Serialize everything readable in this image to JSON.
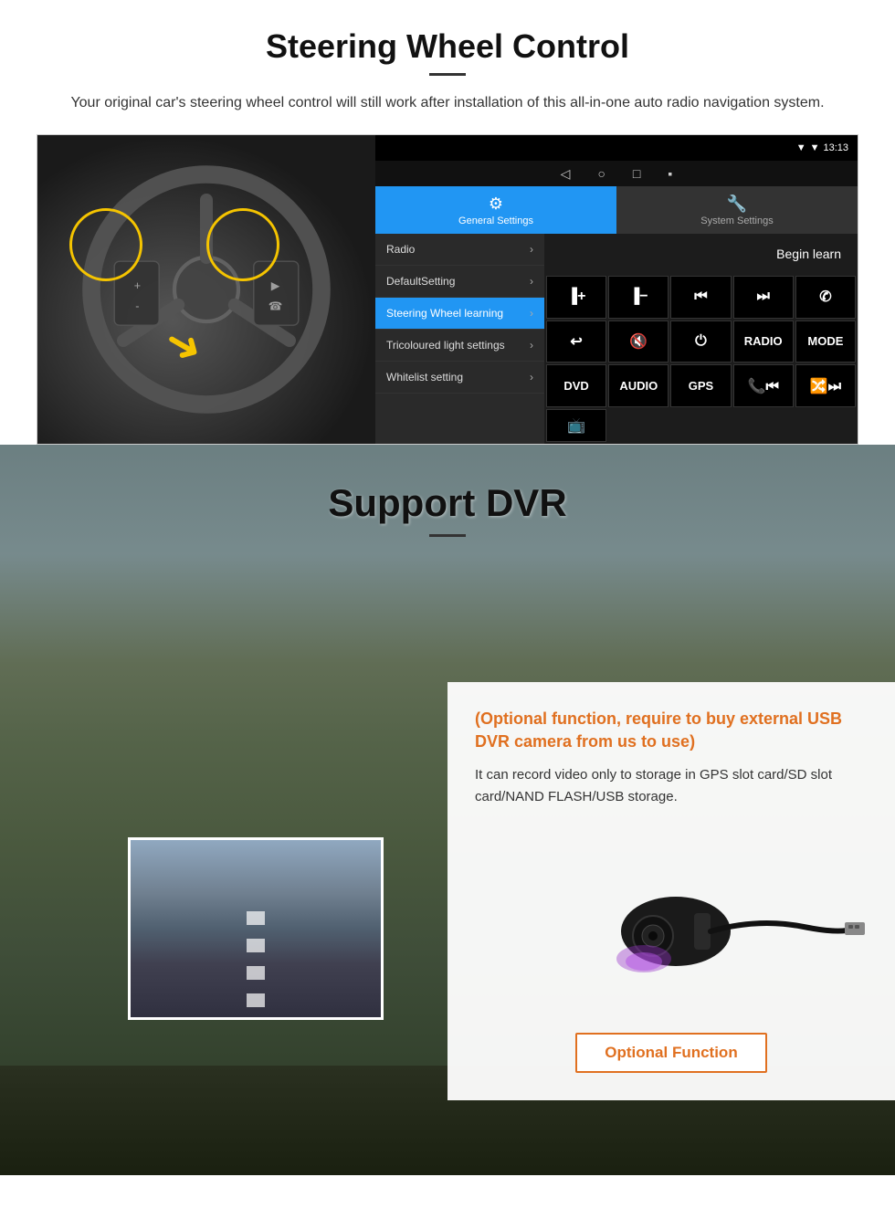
{
  "steering": {
    "title": "Steering Wheel Control",
    "subtitle": "Your original car's steering wheel control will still work after installation of this all-in-one auto radio navigation system.",
    "statusbar": {
      "time": "13:13",
      "icons": "▼ ▼"
    },
    "nav_icons": [
      "◁",
      "○",
      "□",
      "▪"
    ],
    "tabs": [
      {
        "label": "General Settings",
        "active": true,
        "icon": "⚙"
      },
      {
        "label": "System Settings",
        "active": false,
        "icon": "🔧"
      }
    ],
    "menu_items": [
      {
        "label": "Radio",
        "active": false
      },
      {
        "label": "DefaultSetting",
        "active": false
      },
      {
        "label": "Steering Wheel learning",
        "active": true
      },
      {
        "label": "Tricoloured light settings",
        "active": false
      },
      {
        "label": "Whitelist setting",
        "active": false
      }
    ],
    "begin_learn": "Begin learn",
    "controls": [
      {
        "label": "▐+",
        "type": "icon"
      },
      {
        "label": "▐-",
        "type": "icon"
      },
      {
        "label": "⏮",
        "type": "icon"
      },
      {
        "label": "⏭",
        "type": "icon"
      },
      {
        "label": "📞",
        "type": "icon"
      },
      {
        "label": "↩",
        "type": "icon"
      },
      {
        "label": "🔇",
        "type": "icon"
      },
      {
        "label": "⏻",
        "type": "icon"
      },
      {
        "label": "RADIO",
        "type": "text"
      },
      {
        "label": "MODE",
        "type": "text"
      },
      {
        "label": "DVD",
        "type": "text"
      },
      {
        "label": "AUDIO",
        "type": "text"
      },
      {
        "label": "GPS",
        "type": "text"
      },
      {
        "label": "📞⏮",
        "type": "icon"
      },
      {
        "label": "🔀⏭",
        "type": "icon"
      },
      {
        "label": "📺",
        "type": "icon"
      }
    ]
  },
  "dvr": {
    "title": "Support DVR",
    "optional_text": "(Optional function, require to buy external USB DVR camera from us to use)",
    "description": "It can record video only to storage in GPS slot card/SD slot card/NAND FLASH/USB storage.",
    "optional_btn_label": "Optional Function"
  }
}
